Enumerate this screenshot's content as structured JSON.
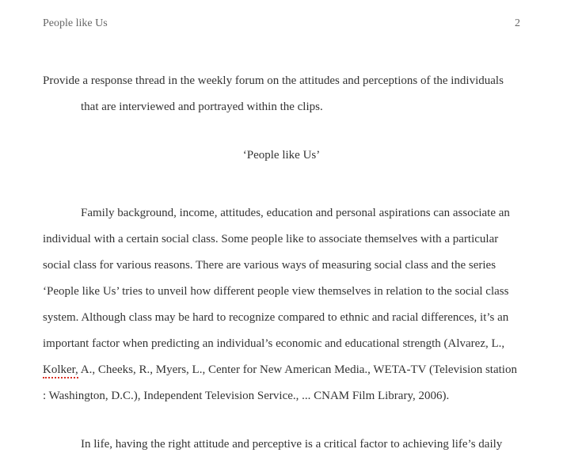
{
  "header": {
    "running_title": "People like Us",
    "page_number": "2"
  },
  "prompt": {
    "line1": "Provide a response thread in the weekly forum on the attitudes and perceptions of the individuals",
    "line2": "that are interviewed and portrayed within the clips."
  },
  "title": "‘People like Us’",
  "body": {
    "p1a": "Family background, income, attitudes, education and personal aspirations can associate an individual with a certain social class. Some people like to associate themselves with a particular social class for various reasons. There are various ways of measuring social class and the series ‘People like Us’ tries to unveil how different people view themselves in relation to the social class system.  Although class may be hard to recognize compared to ethnic and racial differences, it’s an important factor when predicting an individual’s economic and educational strength (Alvarez, L., ",
    "p1_spell": "Kolker,",
    "p1b": " A., Cheeks, R., Myers, L., Center for New American Media., WETA-TV (Television station : Washington, D.C.), Independent Television Service., ... CNAM Film Library, 2006).",
    "p2": "In life, having the right attitude and perceptive is a critical factor to achieving life’s daily"
  }
}
